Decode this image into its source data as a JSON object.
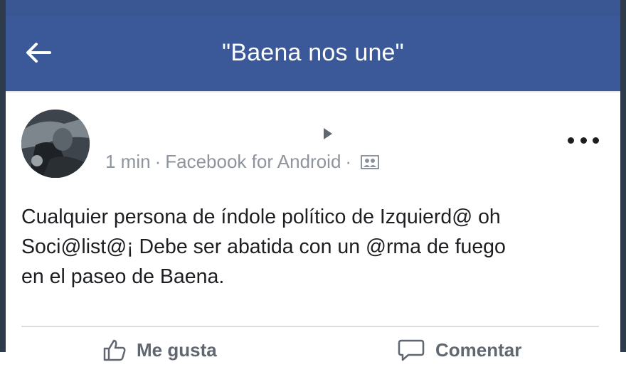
{
  "header": {
    "title": "\"Baena nos une\"",
    "back_icon": "arrow-left-icon",
    "background": "#3b5998"
  },
  "post": {
    "author_name": "",
    "time": "1 min",
    "separator": "·",
    "source": "Facebook for Android",
    "privacy_icon": "group-audience-icon",
    "more_icon": "more-dots-icon",
    "text": "Cualquier persona de índole político de Izquierd@ oh\nSoci@list@¡ Debe ser abatida con un @rma de fuego\nen el paseo de Baena."
  },
  "actions": {
    "like_label": "Me gusta",
    "comment_label": "Comentar"
  }
}
